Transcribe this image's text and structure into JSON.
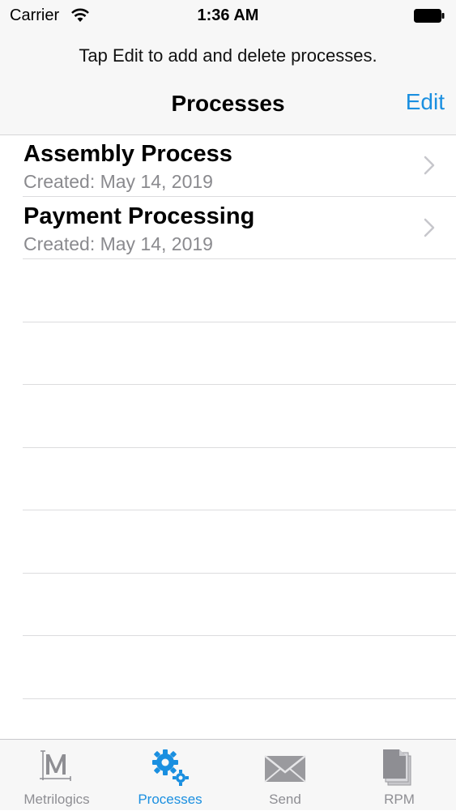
{
  "status": {
    "carrier": "Carrier",
    "time": "1:36 AM"
  },
  "header": {
    "prompt": "Tap Edit to add and delete processes.",
    "title": "Processes",
    "edit_label": "Edit"
  },
  "processes": [
    {
      "name": "Assembly Process",
      "created": "Created: May 14, 2019"
    },
    {
      "name": "Payment Processing",
      "created": "Created: May 14, 2019"
    }
  ],
  "tabs": [
    {
      "label": "Metrilogics",
      "icon": "metrilogics-logo-icon",
      "active": false
    },
    {
      "label": "Processes",
      "icon": "gears-icon",
      "active": true
    },
    {
      "label": "Send",
      "icon": "envelope-icon",
      "active": false
    },
    {
      "label": "RPM",
      "icon": "documents-icon",
      "active": false
    }
  ],
  "colors": {
    "accent": "#1a8fe0",
    "inactive_tab": "#8e8e93",
    "chrome_bg": "#f7f7f7",
    "subtitle": "#8a8a8e"
  }
}
